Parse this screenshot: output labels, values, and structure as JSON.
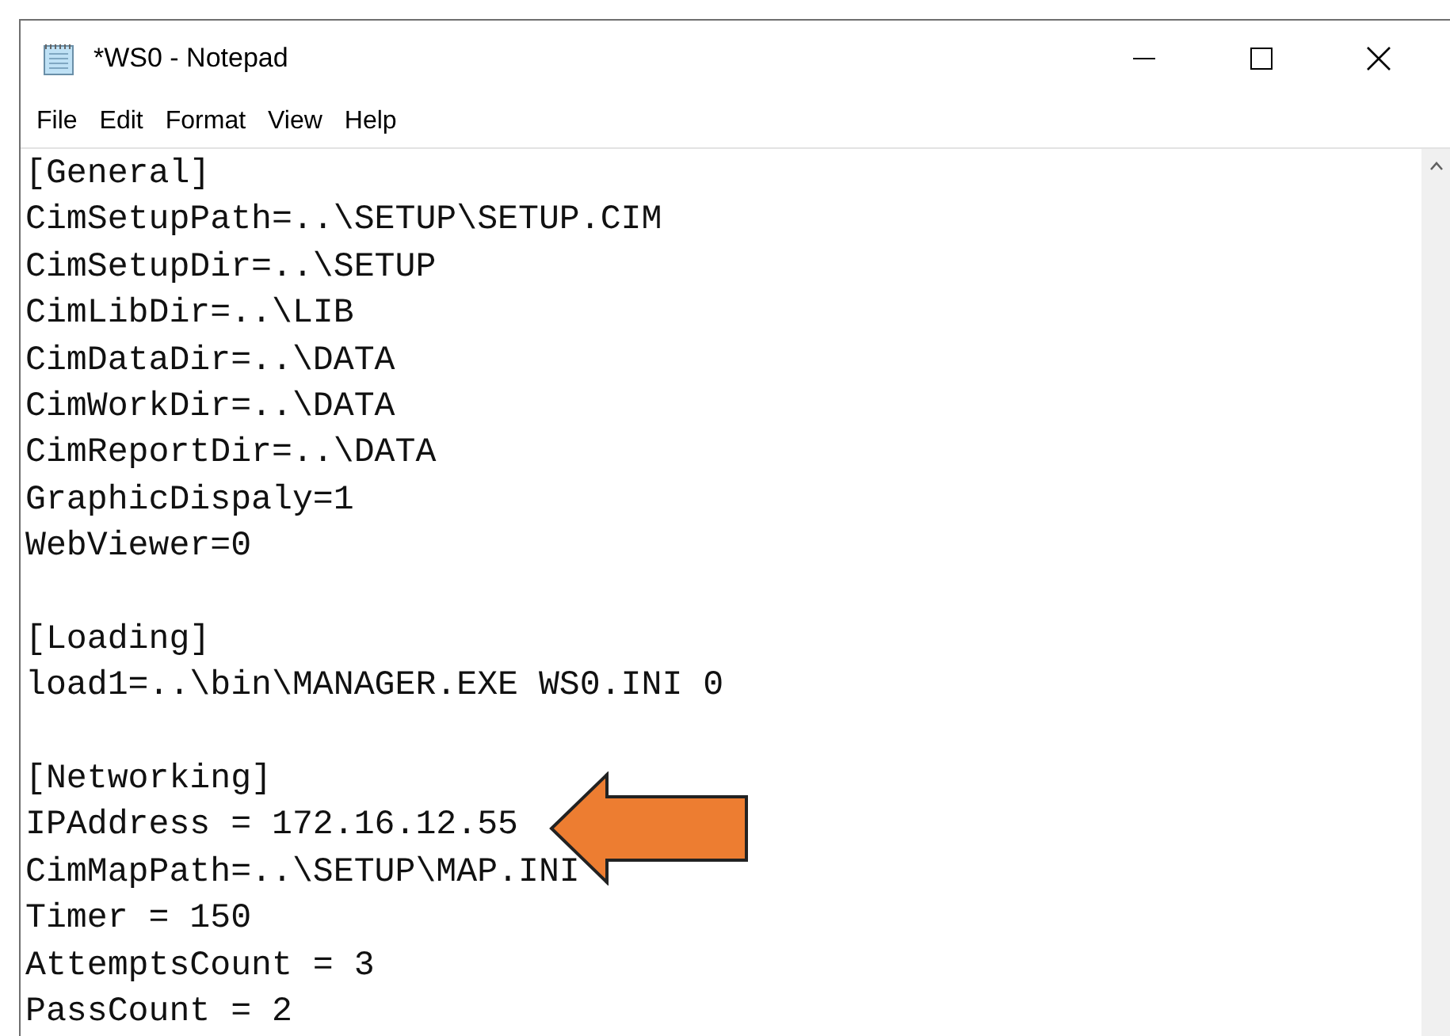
{
  "window": {
    "title": "*WS0 - Notepad"
  },
  "menu": [
    {
      "label": "File"
    },
    {
      "label": "Edit"
    },
    {
      "label": "Format"
    },
    {
      "label": "View"
    },
    {
      "label": "Help"
    }
  ],
  "editor": {
    "lines": [
      {
        "kind": "text",
        "text": "[General]"
      },
      {
        "kind": "text",
        "text": "CimSetupPath=..\\SETUP\\SETUP.CIM"
      },
      {
        "kind": "text",
        "text": "CimSetupDir=..\\SETUP"
      },
      {
        "kind": "text",
        "text": "CimLibDir=..\\LIB"
      },
      {
        "kind": "text",
        "text": "CimDataDir=..\\DATA"
      },
      {
        "kind": "text",
        "text": "CimWorkDir=..\\DATA"
      },
      {
        "kind": "text",
        "text": "CimReportDir=..\\DATA"
      },
      {
        "kind": "text",
        "text": "GraphicDispaly=1"
      },
      {
        "kind": "text",
        "text": "WebViewer=0"
      },
      {
        "kind": "blank"
      },
      {
        "kind": "text",
        "text": "[Loading]"
      },
      {
        "kind": "text",
        "text": "load1=..\\bin\\MANAGER.EXE WS0.INI 0"
      },
      {
        "kind": "blank"
      },
      {
        "kind": "text",
        "text": "[Networking]"
      },
      {
        "kind": "text",
        "text": "IPAddress = 172.16.12.55"
      },
      {
        "kind": "text",
        "text": "CimMapPath=..\\SETUP\\MAP.INI"
      },
      {
        "kind": "text",
        "text": "Timer = 150"
      },
      {
        "kind": "text",
        "text": "AttemptsCount = 3"
      },
      {
        "kind": "text",
        "text": "PassCount = 2"
      }
    ]
  }
}
